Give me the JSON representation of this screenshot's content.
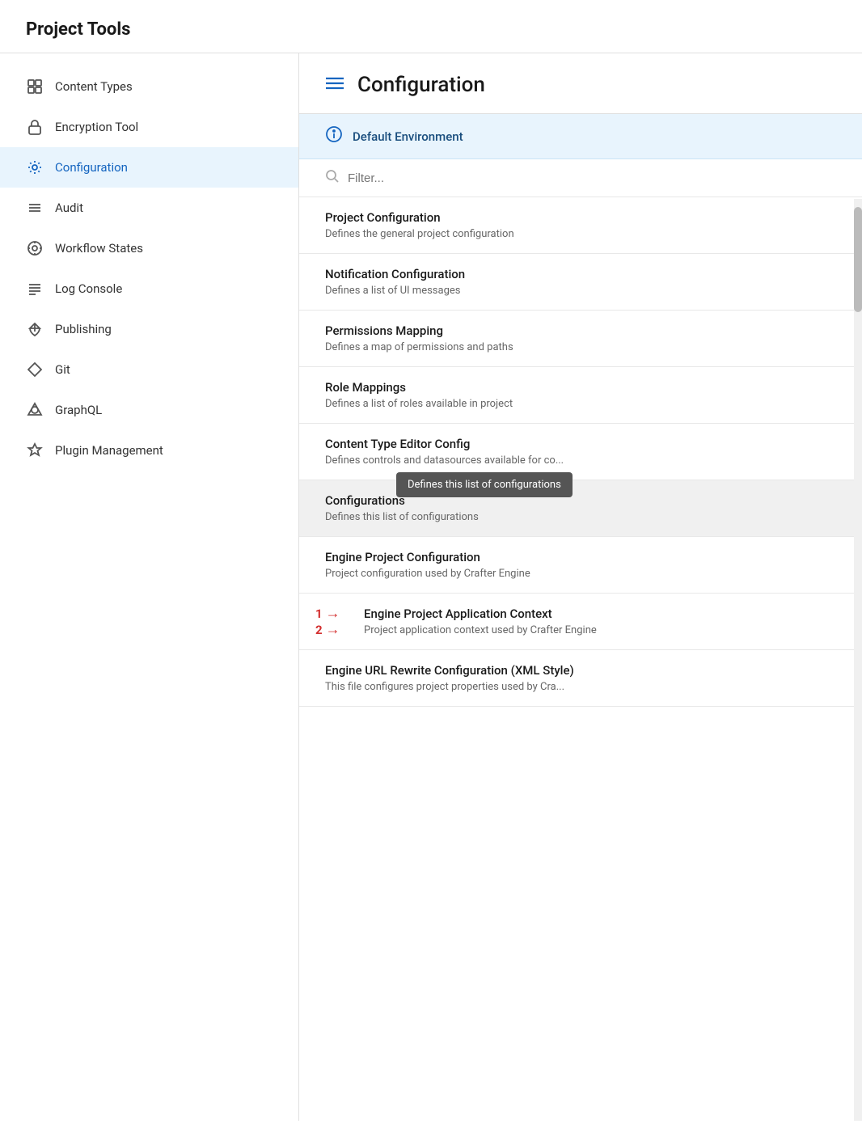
{
  "page": {
    "title": "Project Tools"
  },
  "sidebar": {
    "items": [
      {
        "id": "content-types",
        "label": "Content Types",
        "icon": "grid"
      },
      {
        "id": "encryption-tool",
        "label": "Encryption Tool",
        "icon": "lock"
      },
      {
        "id": "configuration",
        "label": "Configuration",
        "icon": "gear",
        "active": true
      },
      {
        "id": "audit",
        "label": "Audit",
        "icon": "lines"
      },
      {
        "id": "workflow-states",
        "label": "Workflow States",
        "icon": "settings-gear"
      },
      {
        "id": "log-console",
        "label": "Log Console",
        "icon": "menu-lines"
      },
      {
        "id": "publishing",
        "label": "Publishing",
        "icon": "cloud-upload"
      },
      {
        "id": "git",
        "label": "Git",
        "icon": "diamond"
      },
      {
        "id": "graphql",
        "label": "GraphQL",
        "icon": "triangle-circle"
      },
      {
        "id": "plugin-management",
        "label": "Plugin Management",
        "icon": "puzzle"
      }
    ]
  },
  "content": {
    "header_icon": "hamburger",
    "title": "Configuration",
    "env_label": "Default Environment",
    "filter_placeholder": "Filter...",
    "config_items": [
      {
        "id": "project-config",
        "title": "Project Configuration",
        "desc": "Defines the general project configuration"
      },
      {
        "id": "notification-config",
        "title": "Notification Configuration",
        "desc": "Defines a list of UI messages"
      },
      {
        "id": "permissions-mapping",
        "title": "Permissions Mapping",
        "desc": "Defines a map of permissions and paths"
      },
      {
        "id": "role-mappings",
        "title": "Role Mappings",
        "desc": "Defines a list of roles available in project"
      },
      {
        "id": "content-type-editor",
        "title": "Content Type Editor Config",
        "desc": "Defines controls and datasources available for co..."
      },
      {
        "id": "configurations",
        "title": "Configurations",
        "desc": "Defines this list of configurations",
        "highlighted": true,
        "tooltip": "Defines this list of configurations"
      },
      {
        "id": "engine-project-config",
        "title": "Engine Project Configuration",
        "desc": "Project configuration used by Crafter Engine"
      },
      {
        "id": "engine-project-app-context",
        "title": "Engine Project Application Context",
        "desc": "Project application context used by Crafter Engine",
        "annotated": true,
        "annotation_num1": "1",
        "annotation_num2": "2"
      },
      {
        "id": "engine-url-rewrite",
        "title": "Engine URL Rewrite Configuration (XML Style)",
        "desc": "This file configures project properties used by Cra..."
      }
    ]
  },
  "icons": {
    "grid": "⊞",
    "lock": "🔒",
    "gear": "⚙",
    "lines": "☰",
    "settings-gear": "⚙",
    "menu-lines": "☰",
    "cloud-upload": "⬆",
    "diamond": "◇",
    "triangle-circle": "△",
    "puzzle": "⬡",
    "hamburger": "≡",
    "info": "ℹ",
    "search": "🔍",
    "arrow": "→"
  }
}
